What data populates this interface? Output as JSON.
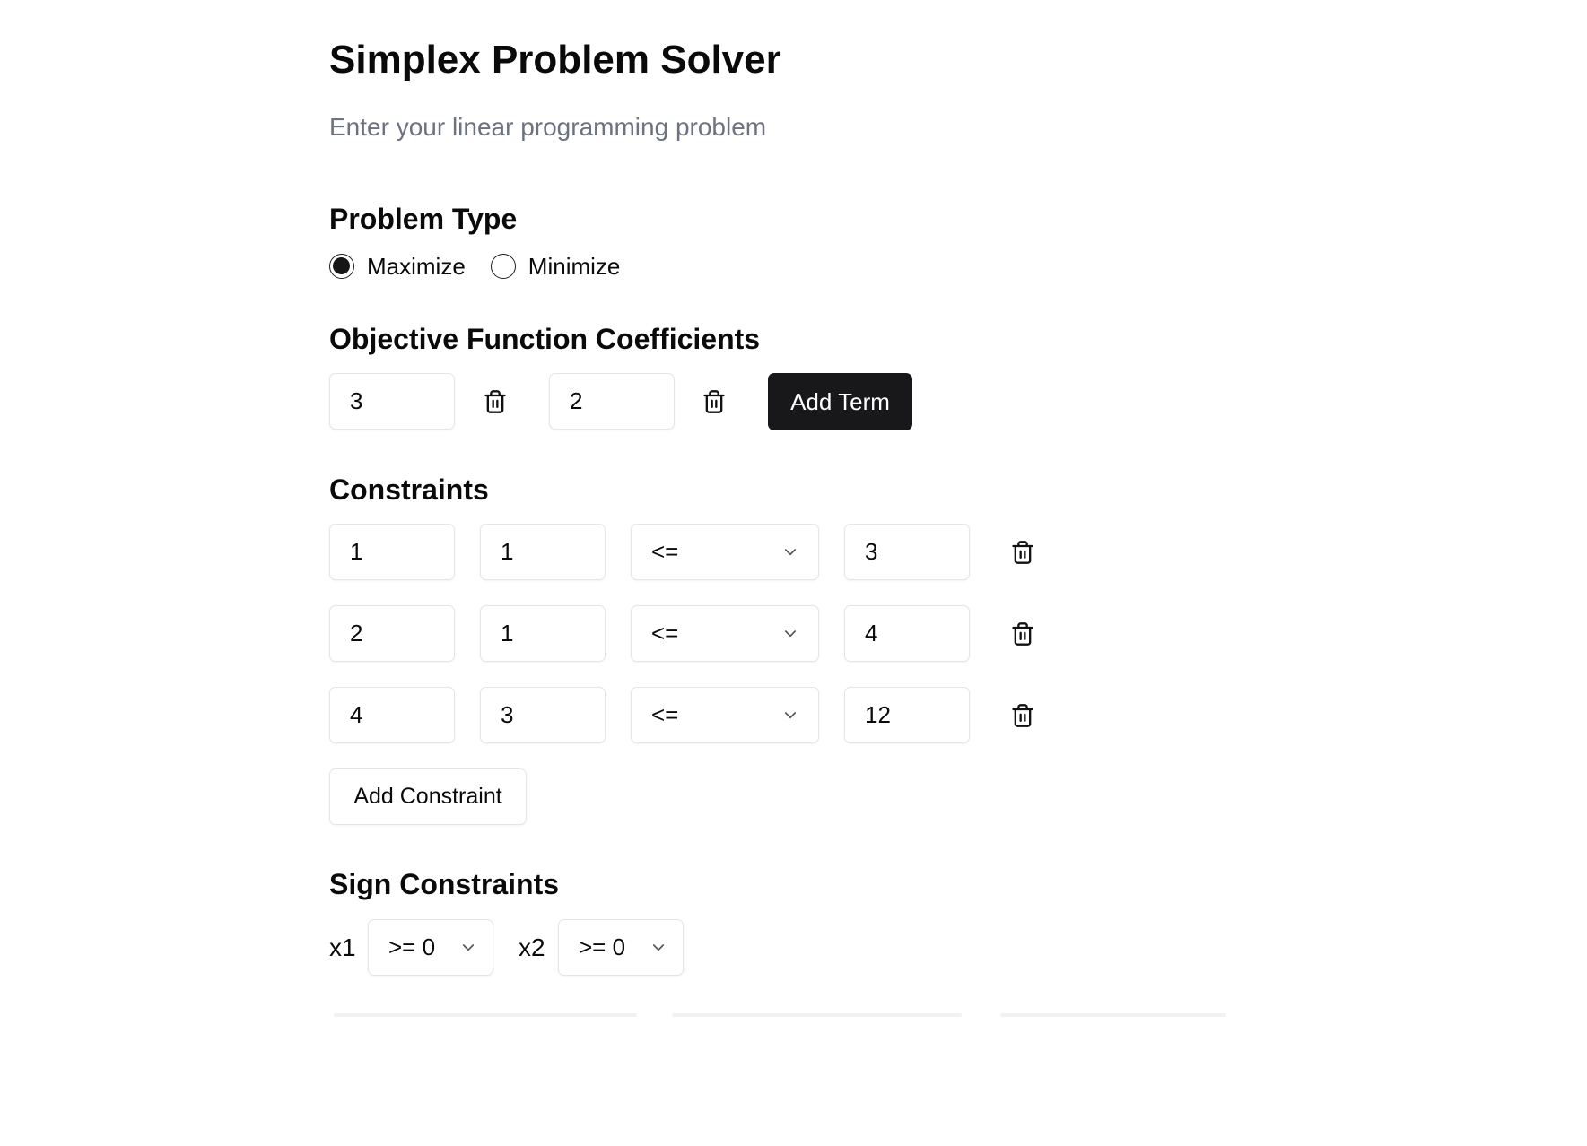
{
  "header": {
    "title": "Simplex Problem Solver",
    "subtitle": "Enter your linear programming problem"
  },
  "problem_type": {
    "heading": "Problem Type",
    "options": [
      "Maximize",
      "Minimize"
    ],
    "selected": "Maximize"
  },
  "objective": {
    "heading": "Objective Function Coefficients",
    "coefficients": [
      "3",
      "2"
    ],
    "add_label": "Add Term"
  },
  "constraints": {
    "heading": "Constraints",
    "rows": [
      {
        "c1": "1",
        "c2": "1",
        "op": "<=",
        "rhs": "3"
      },
      {
        "c1": "2",
        "c2": "1",
        "op": "<=",
        "rhs": "4"
      },
      {
        "c1": "4",
        "c2": "3",
        "op": "<=",
        "rhs": "12"
      }
    ],
    "add_label": "Add Constraint"
  },
  "sign_constraints": {
    "heading": "Sign Constraints",
    "vars": [
      {
        "name": "x1",
        "value": ">= 0"
      },
      {
        "name": "x2",
        "value": ">= 0"
      }
    ]
  },
  "icons": {
    "delete": "trash-icon",
    "dropdown": "chevron-down-icon"
  }
}
